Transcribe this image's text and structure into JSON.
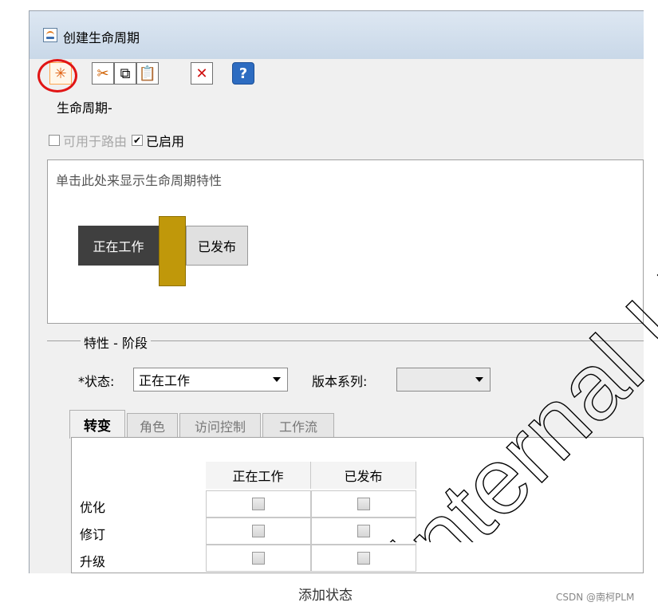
{
  "window": {
    "title": "创建生命周期"
  },
  "toolbar": {
    "new_icon": "new-sparkle-icon",
    "cut_icon": "scissors-icon",
    "copy_icon": "copy-icon",
    "paste_icon": "paste-icon",
    "delete_icon": "delete-x-icon",
    "help_icon": "help-question-icon"
  },
  "lifecycle": {
    "name_label": "生命周期-"
  },
  "options": {
    "routing_label": "可用于路由",
    "routing_checked": false,
    "enabled_label": "已启用",
    "enabled_checked": true
  },
  "properties": {
    "hint": "单击此处来显示生命周期特性",
    "phases": [
      "正在工作",
      "已发布"
    ]
  },
  "phase_group": {
    "title": "特性 - 阶段",
    "state_label": "*状态:",
    "state_value": "正在工作",
    "series_label": "版本系列:",
    "series_value": ""
  },
  "tabs": [
    "转变",
    "角色",
    "访问控制",
    "工作流"
  ],
  "transitions": {
    "columns": [
      "正在工作",
      "已发布"
    ],
    "rows": [
      "优化",
      "修订",
      "升级"
    ]
  },
  "caption": "添加状态",
  "credit": "CSDN @南柯PLM",
  "watermark": "Internal Use Only",
  "colors": {
    "highlight_ring": "#e11515",
    "gate": "#c0980a",
    "working_phase": "#3f3f3f"
  }
}
